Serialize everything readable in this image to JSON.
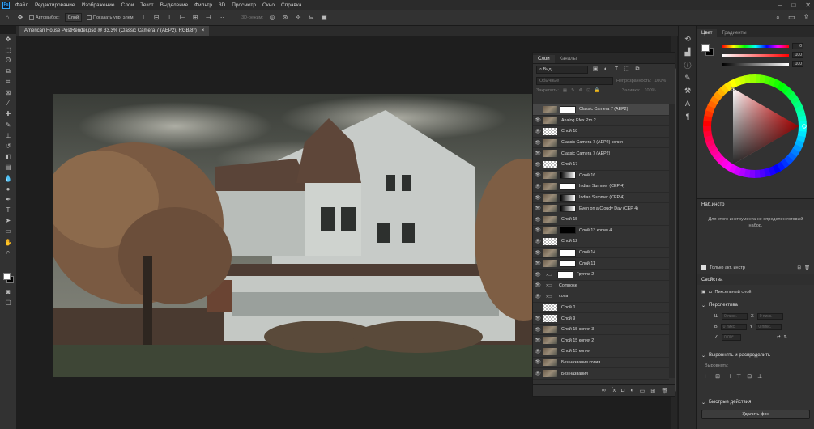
{
  "app": {
    "logo": "Ps"
  },
  "menu": [
    "Файл",
    "Редактирование",
    "Изображение",
    "Слои",
    "Текст",
    "Выделение",
    "Фильтр",
    "3D",
    "Просмотр",
    "Окно",
    "Справка"
  ],
  "options": {
    "auto_select_label": "Автовыбор:",
    "auto_select_value": "Слой",
    "show_transform_label": "Показать упр. элем.",
    "mode3d_label": "3D-режим:"
  },
  "document": {
    "tab_title": "American House PostRender.psd @ 33,3% (Classic Camera 7 (AEP2), RGB/8*)",
    "close": "×"
  },
  "layers_panel": {
    "tabs": [
      "Слои",
      "Каналы"
    ],
    "filter_kind": "Вид",
    "blend_mode": "Обычные",
    "opacity_label": "Непрозрачность:",
    "opacity_value": "100%",
    "lock_label": "Закрепить:",
    "fill_label": "Заливка:",
    "fill_value": "100%",
    "layers": [
      {
        "name": "Classic Camera 7 (AEP2)",
        "visible": false,
        "kind": "photo",
        "mask": "white",
        "selected": true
      },
      {
        "name": "Analog Efex Pro 2",
        "visible": true,
        "kind": "photo",
        "mask": ""
      },
      {
        "name": "Слой 18",
        "visible": true,
        "kind": "trans",
        "mask": ""
      },
      {
        "name": "Classic Camera 7 (AEP2) копия",
        "visible": true,
        "kind": "photo",
        "mask": ""
      },
      {
        "name": "Classic Camera 7 (AEP2)",
        "visible": true,
        "kind": "photo",
        "mask": ""
      },
      {
        "name": "Слой 17",
        "visible": true,
        "kind": "trans",
        "mask": ""
      },
      {
        "name": "Слой 16",
        "visible": true,
        "kind": "photo",
        "mask": "grad"
      },
      {
        "name": "Indian Summer (CEP 4)",
        "visible": true,
        "kind": "photo",
        "mask": "white"
      },
      {
        "name": "Indian Summer (CEP 4)",
        "visible": true,
        "kind": "photo",
        "mask": "grad"
      },
      {
        "name": "Even on a Cloudy Day (CEP 4)",
        "visible": true,
        "kind": "photo",
        "mask": "grad"
      },
      {
        "name": "Слой 15",
        "visible": true,
        "kind": "photo",
        "mask": ""
      },
      {
        "name": "Слой 13 копия 4",
        "visible": true,
        "kind": "photo",
        "mask": "black"
      },
      {
        "name": "Слой 12",
        "visible": true,
        "kind": "trans",
        "mask": ""
      },
      {
        "name": "Слой 14",
        "visible": true,
        "kind": "photo",
        "mask": "white"
      },
      {
        "name": "Слой 11",
        "visible": true,
        "kind": "photo",
        "mask": "white"
      },
      {
        "name": "Группа 2",
        "visible": true,
        "kind": "folder",
        "mask": "white"
      },
      {
        "name": "Compose",
        "visible": true,
        "kind": "folder",
        "mask": ""
      },
      {
        "name": "сопа",
        "visible": true,
        "kind": "folder",
        "mask": ""
      },
      {
        "name": "Слой 0",
        "visible": false,
        "kind": "trans",
        "mask": ""
      },
      {
        "name": "Слой 9",
        "visible": true,
        "kind": "trans",
        "mask": ""
      },
      {
        "name": "Слой 15 копия 3",
        "visible": true,
        "kind": "photo",
        "mask": ""
      },
      {
        "name": "Слой 15 копия 2",
        "visible": true,
        "kind": "photo",
        "mask": ""
      },
      {
        "name": "Слой 15 копия",
        "visible": true,
        "kind": "photo",
        "mask": ""
      },
      {
        "name": "Без названия копия",
        "visible": true,
        "kind": "photo",
        "mask": ""
      },
      {
        "name": "Без названия",
        "visible": true,
        "kind": "photo",
        "mask": ""
      }
    ],
    "bottom_icons": [
      "link-icon",
      "fx-icon",
      "mask-icon",
      "adjustment-icon",
      "group-icon",
      "new-layer-icon",
      "trash-icon"
    ]
  },
  "color_panel": {
    "tabs": [
      "Цвет",
      "Градиенты"
    ],
    "values": [
      "0",
      "100",
      "100"
    ],
    "fg": "#ffffff",
    "bg": "#000000"
  },
  "presets": {
    "title": "Наб.инстр",
    "message": "Для этого инструмента не определен готовый набор.",
    "only_current_label": "Только акт. инстр"
  },
  "properties": {
    "title": "Свойства",
    "pixel_layer": "Пиксельный слой",
    "transform_title": "Перспектива",
    "w_label": "Ш",
    "h_label": "В",
    "x_label": "X",
    "y_label": "Y",
    "w_value": "0 пикс.",
    "h_value": "0 пикс.",
    "x_value": "0 пикс.",
    "y_value": "0 пикс.",
    "angle_value": "0,00°",
    "align_title": "Выровнять и распределить",
    "align_label": "Выровнять:",
    "quick_title": "Быстрые действия",
    "remove_bg": "Удалить фон"
  }
}
